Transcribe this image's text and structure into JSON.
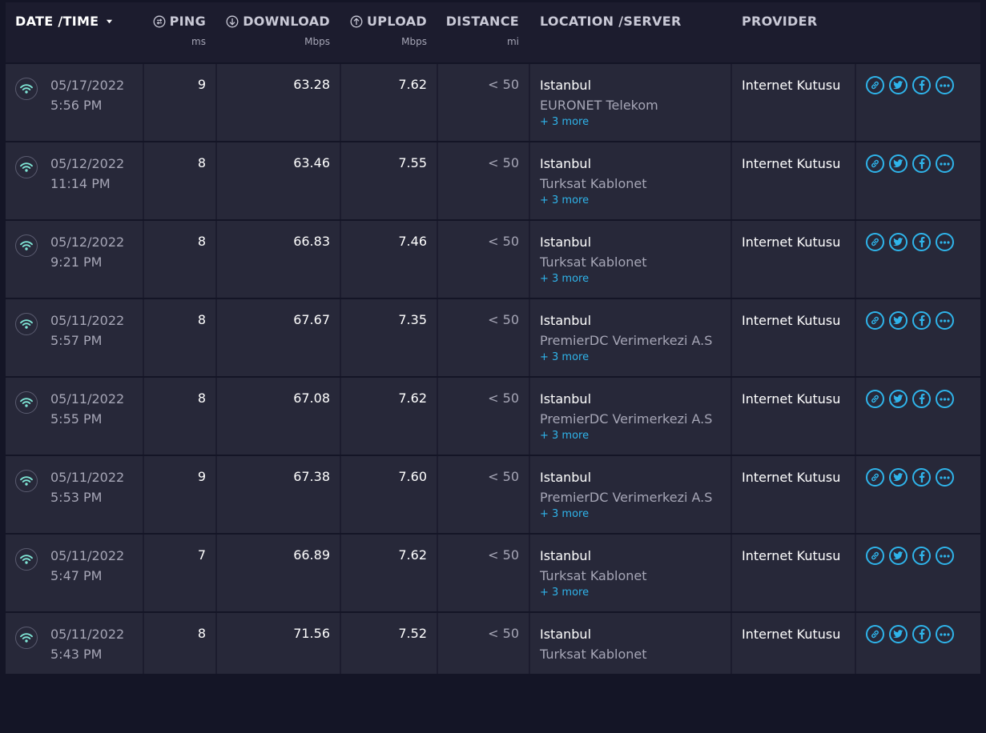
{
  "header": {
    "date_time": "DATE /TIME",
    "ping": "PING",
    "ping_unit": "ms",
    "download": "DOWNLOAD",
    "download_unit": "Mbps",
    "upload": "UPLOAD",
    "upload_unit": "Mbps",
    "distance": "DISTANCE",
    "distance_unit": "mi",
    "location": "LOCATION /SERVER",
    "provider": "PROVIDER"
  },
  "icons": {
    "connection": "wifi-icon",
    "ping": "ping-icon",
    "download": "download-arrow-icon",
    "upload": "upload-arrow-icon",
    "sort": "sort-caret-down-icon",
    "actions": [
      "link-icon",
      "twitter-icon",
      "facebook-icon",
      "more-options-icon"
    ]
  },
  "colors": {
    "accent": "#2fb4ea",
    "wifi": "#7fe5d5",
    "row_bg": "#272839",
    "header_bg": "#1c1c2e"
  },
  "rows": [
    {
      "date": "05/17/2022",
      "time": "5:56 PM",
      "ping": "9",
      "download": "63.28",
      "upload": "7.62",
      "distance": "< 50",
      "city": "Istanbul",
      "sponsor": "EURONET Telekom",
      "more": "+ 3 more",
      "provider": "Internet Kutusu"
    },
    {
      "date": "05/12/2022",
      "time": "11:14 PM",
      "ping": "8",
      "download": "63.46",
      "upload": "7.55",
      "distance": "< 50",
      "city": "Istanbul",
      "sponsor": "Turksat Kablonet",
      "more": "+ 3 more",
      "provider": "Internet Kutusu"
    },
    {
      "date": "05/12/2022",
      "time": "9:21 PM",
      "ping": "8",
      "download": "66.83",
      "upload": "7.46",
      "distance": "< 50",
      "city": "Istanbul",
      "sponsor": "Turksat Kablonet",
      "more": "+ 3 more",
      "provider": "Internet Kutusu"
    },
    {
      "date": "05/11/2022",
      "time": "5:57 PM",
      "ping": "8",
      "download": "67.67",
      "upload": "7.35",
      "distance": "< 50",
      "city": "Istanbul",
      "sponsor": "PremierDC Verimerkezi A.S",
      "more": "+ 3 more",
      "provider": "Internet Kutusu"
    },
    {
      "date": "05/11/2022",
      "time": "5:55 PM",
      "ping": "8",
      "download": "67.08",
      "upload": "7.62",
      "distance": "< 50",
      "city": "Istanbul",
      "sponsor": "PremierDC Verimerkezi A.S",
      "more": "+ 3 more",
      "provider": "Internet Kutusu"
    },
    {
      "date": "05/11/2022",
      "time": "5:53 PM",
      "ping": "9",
      "download": "67.38",
      "upload": "7.60",
      "distance": "< 50",
      "city": "Istanbul",
      "sponsor": "PremierDC Verimerkezi A.S",
      "more": "+ 3 more",
      "provider": "Internet Kutusu"
    },
    {
      "date": "05/11/2022",
      "time": "5:47 PM",
      "ping": "7",
      "download": "66.89",
      "upload": "7.62",
      "distance": "< 50",
      "city": "Istanbul",
      "sponsor": "Turksat Kablonet",
      "more": "+ 3 more",
      "provider": "Internet Kutusu"
    },
    {
      "date": "05/11/2022",
      "time": "5:43 PM",
      "ping": "8",
      "download": "71.56",
      "upload": "7.52",
      "distance": "< 50",
      "city": "Istanbul",
      "sponsor": "Turksat Kablonet",
      "more": "",
      "provider": "Internet Kutusu"
    }
  ]
}
